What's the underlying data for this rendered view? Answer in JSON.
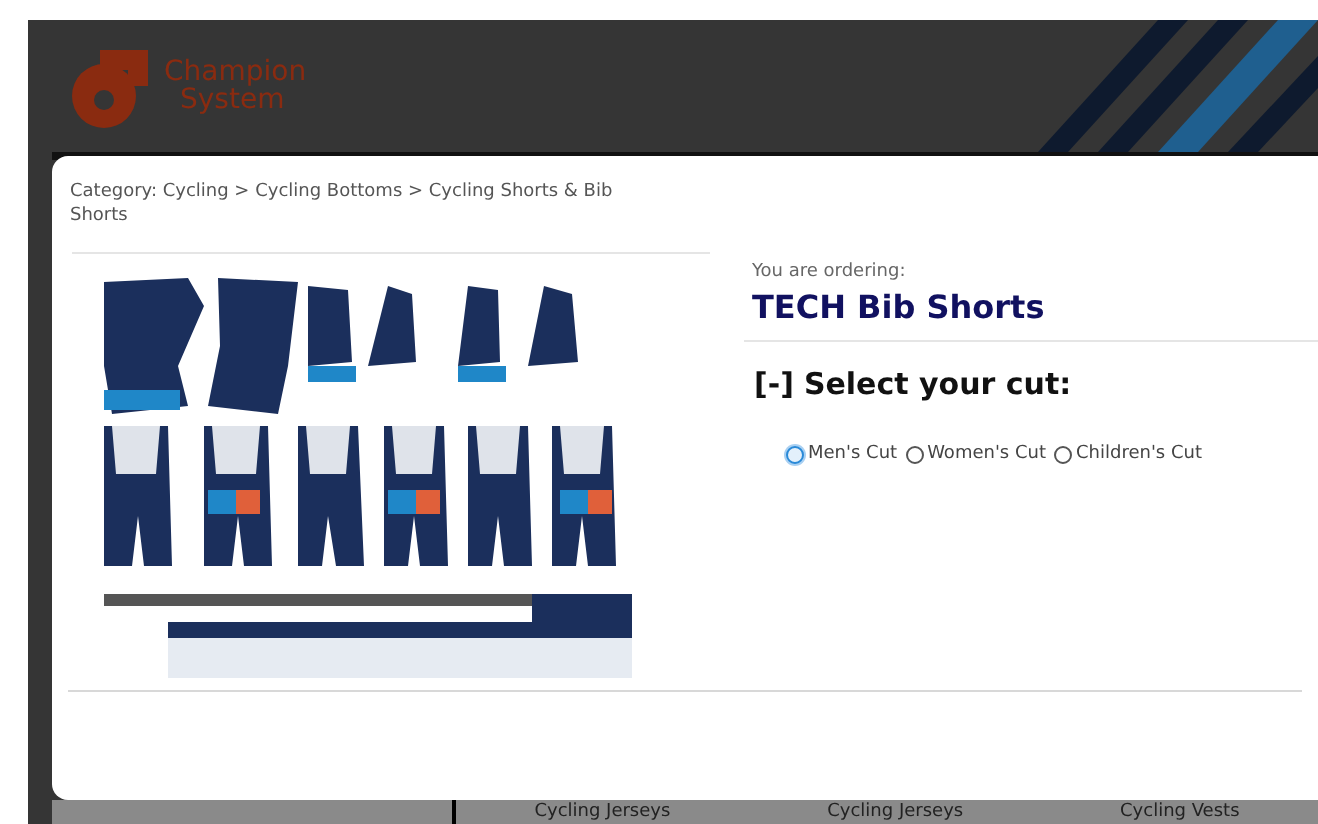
{
  "header": {
    "logo_text": [
      "Champion",
      "System"
    ]
  },
  "background_links": [
    "Cycling Jerseys",
    "Cycling Jerseys",
    "Cycling Vests"
  ],
  "modal": {
    "breadcrumb": "Category: Cycling > Cycling Bottoms > Cycling Shorts & Bib Shorts",
    "ordering_label": "You are ordering:",
    "product_name": "TECH Bib Shorts",
    "section_toggle": "[-]",
    "section_title": "Select your cut:",
    "cuts": [
      {
        "label": "Men's Cut",
        "selected": false,
        "focused": true
      },
      {
        "label": "Women's Cut",
        "selected": false,
        "focused": false
      },
      {
        "label": "Children's Cut",
        "selected": false,
        "focused": false
      }
    ]
  }
}
